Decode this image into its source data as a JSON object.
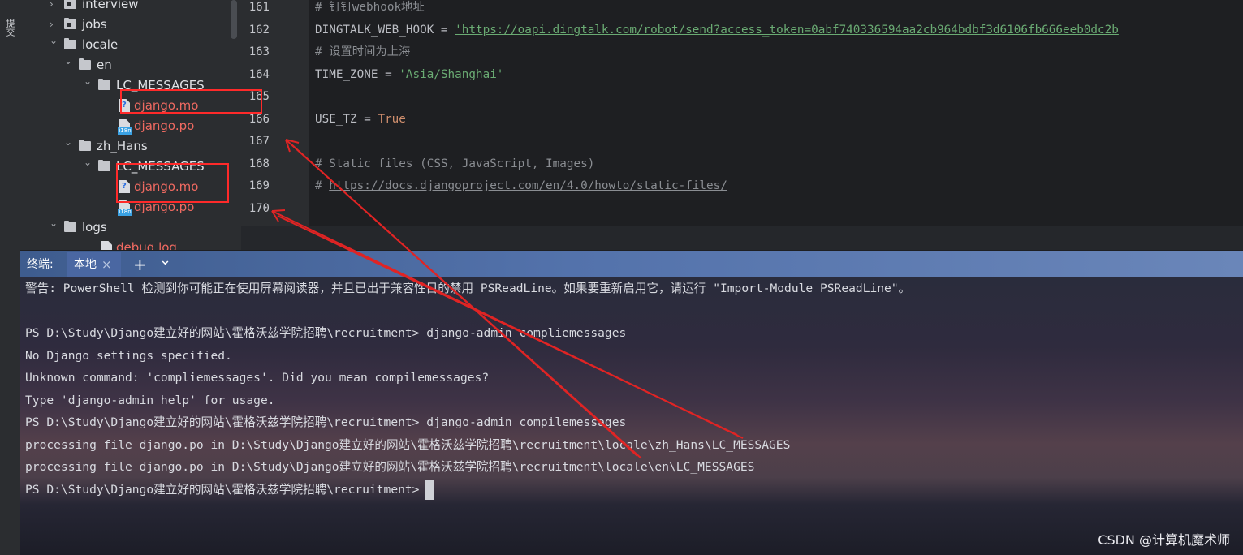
{
  "side_strip": {
    "tab_label": "提交"
  },
  "tree": {
    "items": [
      {
        "label": "interview",
        "kind": "folder",
        "expanded": false,
        "color": "normal"
      },
      {
        "label": "jobs",
        "kind": "folder",
        "expanded": false,
        "color": "normal"
      },
      {
        "label": "locale",
        "kind": "folder",
        "expanded": true,
        "color": "normal"
      },
      {
        "label": "en",
        "kind": "folder",
        "expanded": true,
        "color": "normal"
      },
      {
        "label": "LC_MESSAGES",
        "kind": "folder",
        "expanded": true,
        "color": "normal"
      },
      {
        "label": "django.mo",
        "kind": "file-mo",
        "color": "red"
      },
      {
        "label": "django.po",
        "kind": "file-po",
        "color": "red"
      },
      {
        "label": "zh_Hans",
        "kind": "folder",
        "expanded": true,
        "color": "normal"
      },
      {
        "label": "LC_MESSAGES",
        "kind": "folder",
        "expanded": true,
        "color": "normal"
      },
      {
        "label": "django.mo",
        "kind": "file-mo",
        "color": "red"
      },
      {
        "label": "django.po",
        "kind": "file-po",
        "color": "red"
      },
      {
        "label": "logs",
        "kind": "folder",
        "expanded": true,
        "color": "normal"
      },
      {
        "label": "debug.log",
        "kind": "file",
        "color": "red"
      }
    ],
    "i18n_badge": "i18n"
  },
  "editor": {
    "line_numbers": [
      "161",
      "162",
      "163",
      "164",
      "165",
      "166",
      "167",
      "168",
      "169",
      "170"
    ],
    "lines": [
      {
        "parts": [
          {
            "text": "# 钉钉webhook地址",
            "cls": "cm"
          }
        ]
      },
      {
        "parts": [
          {
            "text": "DINGTALK_WEB_HOOK = ",
            "cls": ""
          },
          {
            "text": "'https://oapi.dingtalk.com/robot/send?access_token=0abf740336594aa2cb964bdbf3d6106fb666eeb0dc2b",
            "cls": "str link"
          }
        ]
      },
      {
        "parts": [
          {
            "text": "# 设置时间为上海",
            "cls": "cm"
          }
        ]
      },
      {
        "parts": [
          {
            "text": "TIME_ZONE = ",
            "cls": ""
          },
          {
            "text": "'Asia/Shanghai'",
            "cls": "str"
          }
        ]
      },
      {
        "parts": []
      },
      {
        "parts": [
          {
            "text": "USE_TZ = ",
            "cls": ""
          },
          {
            "text": "True",
            "cls": "kw"
          }
        ]
      },
      {
        "parts": []
      },
      {
        "parts": [
          {
            "text": "# Static files (CSS, JavaScript, Images)",
            "cls": "cm"
          }
        ]
      },
      {
        "parts": [
          {
            "text": "# ",
            "cls": "cm"
          },
          {
            "text": "https://docs.djangoproject.com/en/4.0/howto/static-files/",
            "cls": "cm link"
          }
        ]
      },
      {
        "parts": []
      }
    ]
  },
  "terminal_bar": {
    "title": "终端:",
    "tab_label": "本地",
    "close_glyph": "×",
    "add_glyph": "+",
    "dropdown_glyph": "⌄"
  },
  "terminal": {
    "lines": [
      "警告: PowerShell 检测到你可能正在使用屏幕阅读器，并且已出于兼容性目的禁用 PSReadLine。如果要重新启用它，请运行 \"Import-Module PSReadLine\"。",
      "",
      "PS D:\\Study\\Django建立好的网站\\霍格沃兹学院招聘\\recruitment> django-admin compliemessages",
      "No Django settings specified.",
      "Unknown command: 'compliemessages'. Did you mean compilemessages?",
      "Type 'django-admin help' for usage.",
      "PS D:\\Study\\Django建立好的网站\\霍格沃兹学院招聘\\recruitment> django-admin compilemessages",
      "processing file django.po in D:\\Study\\Django建立好的网站\\霍格沃兹学院招聘\\recruitment\\locale\\zh_Hans\\LC_MESSAGES",
      "processing file django.po in D:\\Study\\Django建立好的网站\\霍格沃兹学院招聘\\recruitment\\locale\\en\\LC_MESSAGES",
      "PS D:\\Study\\Django建立好的网站\\霍格沃兹学院招聘\\recruitment>"
    ]
  },
  "watermark": "CSDN @计算机魔术师",
  "colors": {
    "annotation_red": "#ff2a2a",
    "vcs_red": "#f06a61",
    "string_green": "#6aab73",
    "keyword_orange": "#cf8e6d"
  }
}
